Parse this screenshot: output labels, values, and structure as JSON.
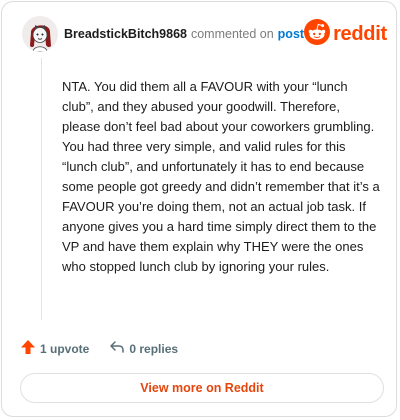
{
  "header": {
    "username": "BreadstickBitch9868",
    "commented_text": "commented on",
    "post_link": "post",
    "brand_name": "reddit"
  },
  "comment": {
    "text": "NTA. You did them all a FAVOUR with your “lunch club”, and they abused your goodwill. Therefore, please don’t feel bad about your coworkers grumbling. You had three very simple, and valid rules for this “lunch club”, and unfortunately it has to end because some people got greedy and didn’t remember that it’s a FAVOUR you’re doing them, not an actual job task. If anyone gives you a hard time simply direct them to the VP and have them explain why THEY were the ones who stopped lunch club by ignoring your rules."
  },
  "actions": {
    "upvote_label": "1 upvote",
    "reply_label": "0 replies"
  },
  "footer": {
    "view_more_label": "View more on Reddit"
  },
  "colors": {
    "brand": "#ff4500",
    "link": "#0079d3",
    "upvote": "#ff4500"
  },
  "icons": {
    "avatar": "snoo-avatar-icon",
    "logo": "reddit-snoo-icon",
    "upvote": "upvote-arrow-icon",
    "reply": "reply-arrow-icon"
  }
}
